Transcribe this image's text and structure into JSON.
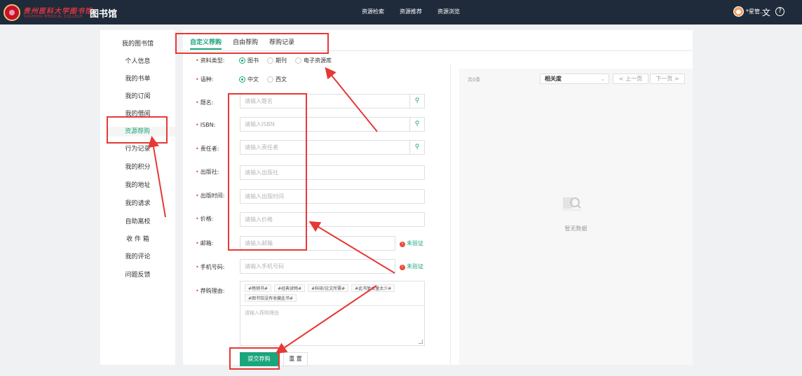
{
  "header": {
    "logo_text": "贵州医科大学图书馆",
    "logo_sub": "GUIZHOU MEDICAL COLLEGE",
    "app_title": "图书馆",
    "nav": [
      "资源检索",
      "资源推荐",
      "资源浏览"
    ],
    "user_name": "*星管...",
    "lang_icon": "translate-icon",
    "help_icon": "help-icon"
  },
  "sidebar": {
    "items": [
      "我的图书馆",
      "个人信息",
      "我的书单",
      "我的订阅",
      "我的借阅",
      "资源荐购",
      "行为记录",
      "我的积分",
      "我的地址",
      "我的请求",
      "自助离校",
      "收 件 箱",
      "我的评论",
      "问题反馈"
    ],
    "active_index": 5
  },
  "tabs": [
    "自定义荐购",
    "自由荐购",
    "荐购记录"
  ],
  "form": {
    "type": {
      "label": "资料类型:",
      "options": [
        "图书",
        "期刊",
        "电子资源库"
      ],
      "selected": 0
    },
    "lang": {
      "label": "语种:",
      "options": [
        "中文",
        "西文"
      ],
      "selected": 0
    },
    "title": {
      "label": "题名:",
      "placeholder": "请输入题名"
    },
    "isbn": {
      "label": "ISBN:",
      "placeholder": "请输入ISBN"
    },
    "author": {
      "label": "责任者:",
      "placeholder": "请输入责任者"
    },
    "publisher": {
      "label": "出版社:",
      "placeholder": "请输入出版社"
    },
    "pubdate": {
      "label": "出版时间:",
      "placeholder": "请输入出版时间"
    },
    "price": {
      "label": "价格:",
      "placeholder": "请输入价格"
    },
    "email": {
      "label": "邮箱:",
      "placeholder": "请输入邮箱",
      "status": "未验证"
    },
    "phone": {
      "label": "手机号码:",
      "placeholder": "请输入手机号码",
      "status": "未验证"
    },
    "reason": {
      "label": "荐购理由:",
      "tags": [
        "#畅销书#",
        "#经典读物#",
        "#科研/论文所需#",
        "#此书复本量太少#",
        "#图书馆没有收藏此书#"
      ],
      "placeholder": "请输入荐购理由"
    },
    "submit": "提交荐购",
    "reset": "重 置"
  },
  "results": {
    "count": "共0条",
    "sort": "相关度",
    "prev": "上一页",
    "next": "下一页",
    "empty": "暂无数据"
  }
}
